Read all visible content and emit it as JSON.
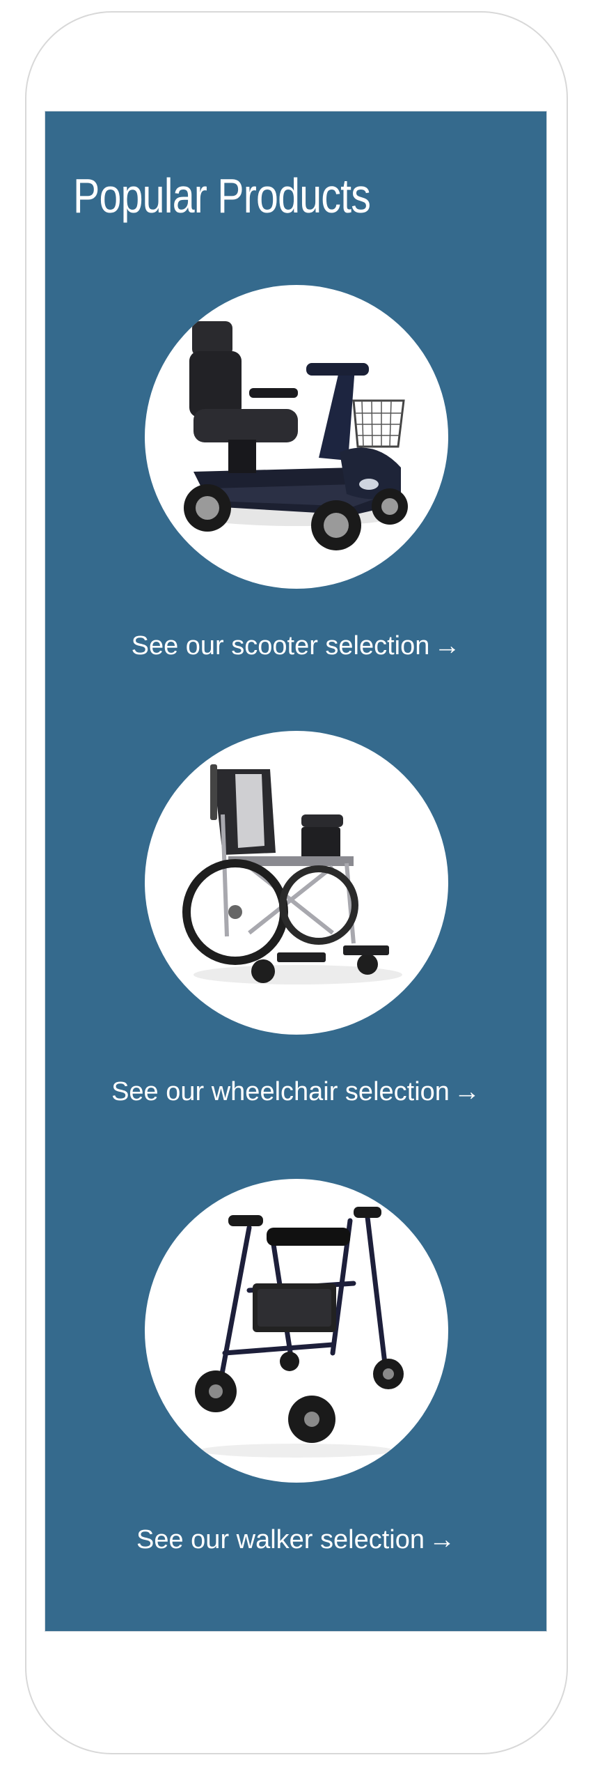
{
  "section": {
    "title": "Popular Products"
  },
  "products": [
    {
      "link_text": "See our scooter selection",
      "arrow": "→",
      "image_icon": "mobility-scooter-icon"
    },
    {
      "link_text": "See our wheelchair selection",
      "arrow": "→",
      "image_icon": "wheelchair-icon"
    },
    {
      "link_text": "See our walker selection",
      "arrow": "→",
      "image_icon": "rollator-walker-icon"
    }
  ],
  "colors": {
    "panel_background": "#356a8d",
    "text": "#ffffff",
    "circle": "#ffffff"
  }
}
